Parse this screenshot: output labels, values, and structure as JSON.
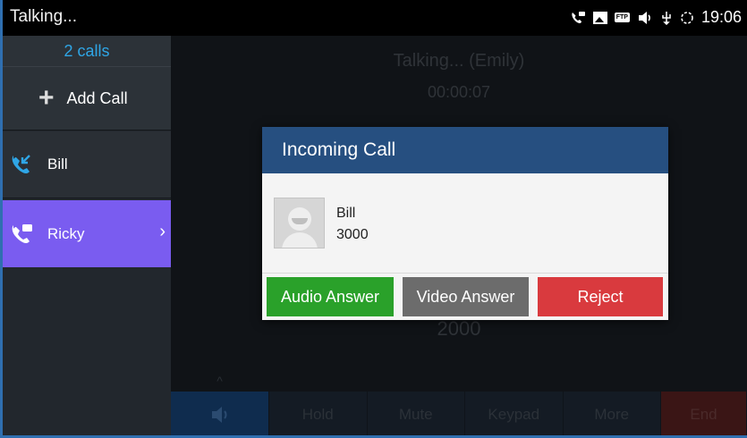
{
  "status_bar": {
    "title": "Talking...",
    "time": "19:06",
    "icons": [
      "voicemail-icon",
      "image-icon",
      "ftp-icon",
      "speaker-icon",
      "usb-icon",
      "sync-icon"
    ]
  },
  "left_panel": {
    "call_count": "2 calls",
    "add_call_label": "Add Call",
    "calls": [
      {
        "name": "Bill",
        "icon": "incoming-call-icon",
        "selected": false
      },
      {
        "name": "Ricky",
        "icon": "voicemail-call-icon",
        "selected": true
      }
    ]
  },
  "main": {
    "talking_with": "Talking... (Emily)",
    "timer": "00:00:07",
    "number_partial": "2000",
    "bottom_bar": [
      "Hold",
      "Mute",
      "Keypad",
      "More",
      "End"
    ]
  },
  "dialog": {
    "title": "Incoming Call",
    "caller_name": "Bill",
    "caller_number": "3000",
    "buttons": {
      "audio": "Audio Answer",
      "video": "Video Answer",
      "reject": "Reject"
    }
  },
  "colors": {
    "accent_purple": "#7a5cf0",
    "dialog_header": "#264f80",
    "answer_green": "#2aa12a",
    "reject_red": "#d93a3e",
    "count_blue": "#2fa6e6"
  }
}
